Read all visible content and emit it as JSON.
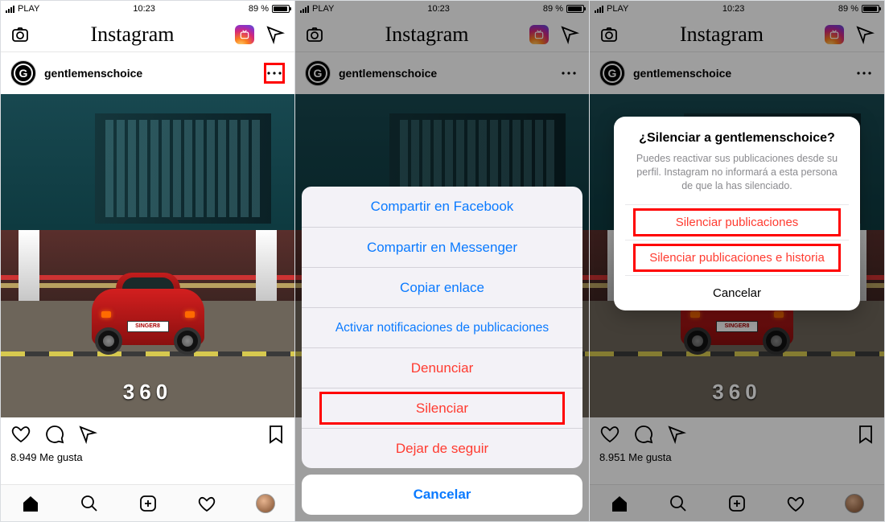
{
  "status": {
    "carrier": "PLAY",
    "time": "10:23",
    "battery": "89 %"
  },
  "header": {
    "title": "Instagram"
  },
  "post": {
    "username": "gentlemenschoice",
    "plate": "SINGER8",
    "ground_mark": "360"
  },
  "likes": {
    "p1": "8.949 Me gusta",
    "p3": "8.951 Me gusta"
  },
  "sheet": {
    "items": [
      "Compartir en Facebook",
      "Compartir en Messenger",
      "Copiar enlace",
      "Activar notificaciones de publicaciones",
      "Denunciar",
      "Silenciar",
      "Dejar de seguir"
    ],
    "cancel": "Cancelar"
  },
  "alert": {
    "title": "¿Silenciar a gentlemenschoice?",
    "body": "Puedes reactivar sus publicaciones desde su perfil. Instagram no informará a esta persona de que la has silenciado.",
    "opt1": "Silenciar publicaciones",
    "opt2": "Silenciar publicaciones e historia",
    "cancel": "Cancelar"
  }
}
